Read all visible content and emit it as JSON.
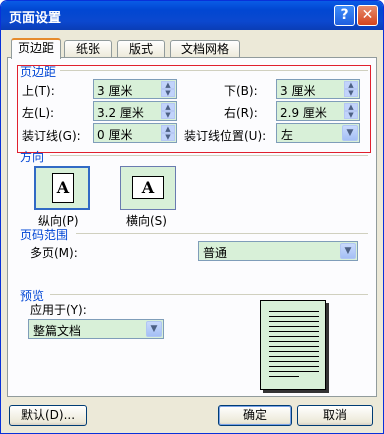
{
  "window": {
    "title": "页面设置"
  },
  "titlebar": {
    "help_label": "?",
    "close_label": "✕"
  },
  "tabs": [
    {
      "label": "页边距",
      "active": true
    },
    {
      "label": "纸张",
      "active": false
    },
    {
      "label": "版式",
      "active": false
    },
    {
      "label": "文档网格",
      "active": false
    }
  ],
  "margins": {
    "section_title": "页边距",
    "top": {
      "label": "上(T):",
      "value": "3 厘米"
    },
    "bottom": {
      "label": "下(B):",
      "value": "3 厘米"
    },
    "left": {
      "label": "左(L):",
      "value": "3.2 厘米"
    },
    "right": {
      "label": "右(R):",
      "value": "2.9 厘米"
    },
    "gutter": {
      "label": "装订线(G):",
      "value": "0 厘米"
    },
    "gutter_position": {
      "label": "装订线位置(U):",
      "value": "左"
    }
  },
  "orientation": {
    "section_title": "方向",
    "portrait": {
      "label": "纵向(P)",
      "glyph": "A",
      "selected": true
    },
    "landscape": {
      "label": "横向(S)",
      "glyph": "A",
      "selected": false
    }
  },
  "pages": {
    "section_title": "页码范围",
    "multiple_label": "多页(M):",
    "multiple_value": "普通"
  },
  "preview": {
    "section_title": "预览",
    "apply_label": "应用于(Y):",
    "apply_value": "整篇文档"
  },
  "buttons": {
    "default": "默认(D)...",
    "ok": "确定",
    "cancel": "取消"
  },
  "colors": {
    "accent": "#0046d5",
    "field_bg": "#d8f0d8",
    "highlight_box": "#e0202e"
  }
}
